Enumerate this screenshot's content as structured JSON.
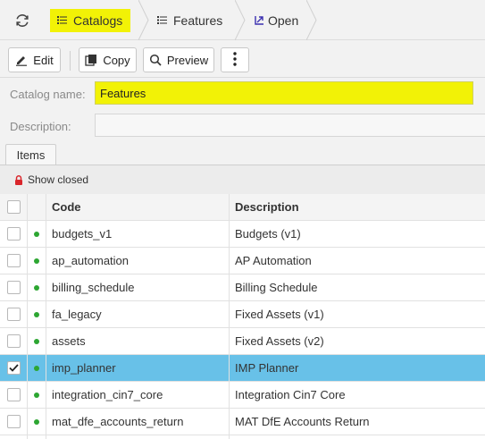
{
  "breadcrumb": {
    "items": [
      {
        "label": "Catalogs",
        "icon": "list-icon",
        "highlighted": true
      },
      {
        "label": "Features",
        "icon": "list-icon",
        "highlighted": false
      },
      {
        "label": "Open",
        "icon": "open-icon",
        "highlighted": false
      }
    ]
  },
  "toolbar": {
    "edit_label": "Edit",
    "copy_label": "Copy",
    "preview_label": "Preview"
  },
  "form": {
    "catalog_name_label": "Catalog name:",
    "catalog_name_value": "Features",
    "description_label": "Description:",
    "description_value": ""
  },
  "tabs": [
    {
      "label": "Items"
    }
  ],
  "grid": {
    "show_closed_label": "Show closed",
    "columns": {
      "code": "Code",
      "description": "Description"
    },
    "rows": [
      {
        "code": "budgets_v1",
        "description": "Budgets (v1)",
        "checked": false,
        "active": true
      },
      {
        "code": "ap_automation",
        "description": "AP Automation",
        "checked": false,
        "active": true
      },
      {
        "code": "billing_schedule",
        "description": "Billing Schedule",
        "checked": false,
        "active": true
      },
      {
        "code": "fa_legacy",
        "description": "Fixed Assets (v1)",
        "checked": false,
        "active": true
      },
      {
        "code": "assets",
        "description": "Fixed Assets (v2)",
        "checked": false,
        "active": true
      },
      {
        "code": "imp_planner",
        "description": "IMP Planner",
        "checked": true,
        "active": true,
        "selected": true
      },
      {
        "code": "integration_cin7_core",
        "description": "Integration Cin7 Core",
        "checked": false,
        "active": true
      },
      {
        "code": "mat_dfe_accounts_return",
        "description": "MAT DfE Accounts Return",
        "checked": false,
        "active": true
      }
    ]
  },
  "colors": {
    "highlight": "#f2f206",
    "selected_row": "#68c1e8",
    "active_dot": "#2da632",
    "lock": "#d9262b"
  }
}
